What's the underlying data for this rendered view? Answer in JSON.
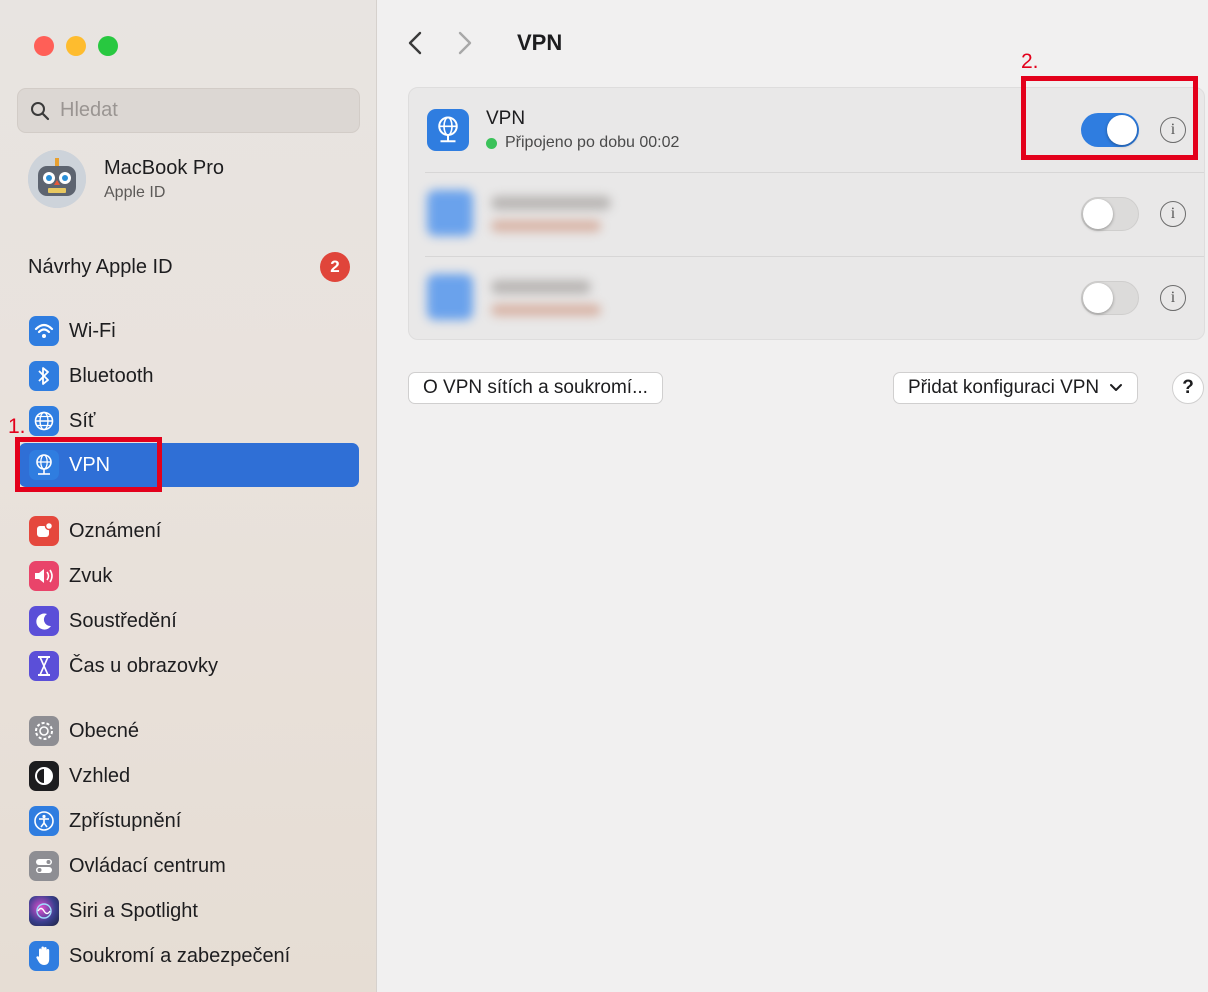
{
  "window": {
    "traffic_colors": [
      "#ff5f57",
      "#febc2e",
      "#28c840"
    ]
  },
  "sidebar": {
    "search_placeholder": "Hledat",
    "account": {
      "name": "MacBook Pro",
      "subtitle": "Apple ID"
    },
    "suggestions": {
      "label": "Návrhy Apple ID",
      "badge": "2"
    },
    "items": [
      {
        "label": "Wi-Fi",
        "icon": "wifi-icon",
        "color": "#2f7de0"
      },
      {
        "label": "Bluetooth",
        "icon": "bluetooth-icon",
        "color": "#2f7de0"
      },
      {
        "label": "Síť",
        "icon": "globe-icon",
        "color": "#2f7de0"
      },
      {
        "label": "VPN",
        "icon": "vpn-globe-icon",
        "color": "#2f7de0",
        "active": true
      },
      {
        "label": "Oznámení",
        "icon": "bell-icon",
        "color": "#e5483d"
      },
      {
        "label": "Zvuk",
        "icon": "speaker-icon",
        "color": "#e9446a"
      },
      {
        "label": "Soustředění",
        "icon": "moon-icon",
        "color": "#5b4fd8"
      },
      {
        "label": "Čas u obrazovky",
        "icon": "hourglass-icon",
        "color": "#5b4fd8"
      },
      {
        "label": "Obecné",
        "icon": "gear-icon",
        "color": "#8e8e93"
      },
      {
        "label": "Vzhled",
        "icon": "appearance-icon",
        "color": "#1d1d1f"
      },
      {
        "label": "Zpřístupnění",
        "icon": "accessibility-icon",
        "color": "#2f7de0"
      },
      {
        "label": "Ovládací centrum",
        "icon": "control-center-icon",
        "color": "#8e8e93"
      },
      {
        "label": "Siri a Spotlight",
        "icon": "siri-icon",
        "color": "#3a3f8f"
      },
      {
        "label": "Soukromí a zabezpečení",
        "icon": "hand-icon",
        "color": "#2f7de0"
      }
    ]
  },
  "main": {
    "title": "VPN",
    "vpn_connections": [
      {
        "name": "VPN",
        "status": "Připojeno po dobu 00:02",
        "status_color": "#3bc25a",
        "enabled": true
      },
      {
        "name": "",
        "status": "",
        "enabled": false,
        "blurred": true
      },
      {
        "name": "",
        "status": "",
        "enabled": false,
        "blurred": true
      }
    ],
    "about_button": "O VPN sítích a soukromí...",
    "add_config_button": "Přidat konfiguraci VPN",
    "help_button": "?"
  },
  "annotations": {
    "label_1": "1.",
    "label_2": "2.",
    "color": "#e3001b"
  }
}
